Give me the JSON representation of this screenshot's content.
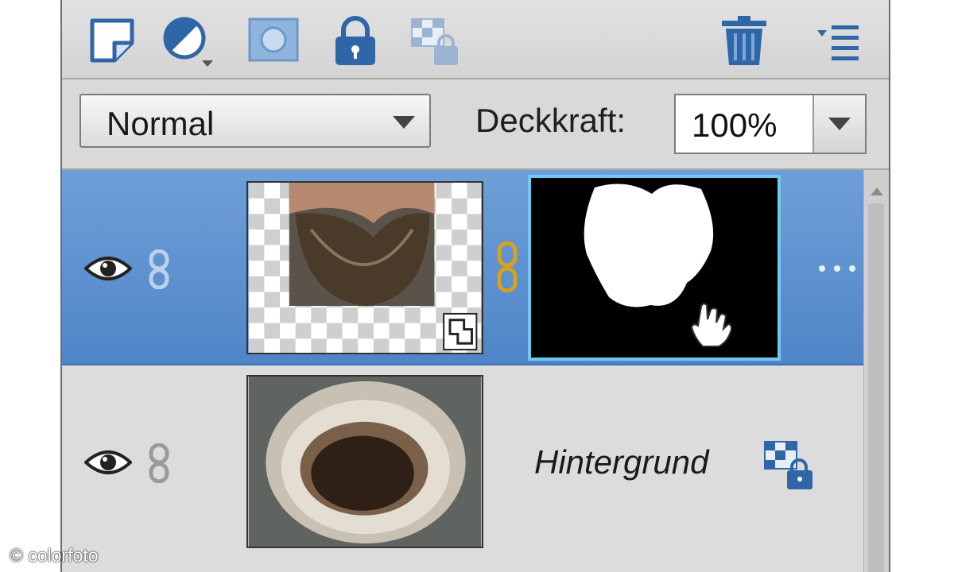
{
  "toolbar": {
    "icons": [
      "new-layer-icon",
      "adjustment-layer-icon",
      "layer-mask-icon",
      "lock-all-icon",
      "lock-transparent-icon",
      "delete-icon",
      "panel-menu-icon"
    ]
  },
  "options": {
    "blend_mode": "Normal",
    "opacity_label": "Deckkraft:",
    "opacity_value": "100%"
  },
  "layers": [
    {
      "name": "",
      "selected": true,
      "visible": true,
      "has_mask": true,
      "more_label": "..."
    },
    {
      "name": "Hintergrund",
      "selected": false,
      "visible": true,
      "locked": true
    }
  ],
  "watermark": "© colorfoto",
  "colors": {
    "selection": "#5a8fcf",
    "mask_border": "#6ec9ee",
    "link_active": "#d9a21b",
    "icon_blue": "#2f66a8"
  }
}
